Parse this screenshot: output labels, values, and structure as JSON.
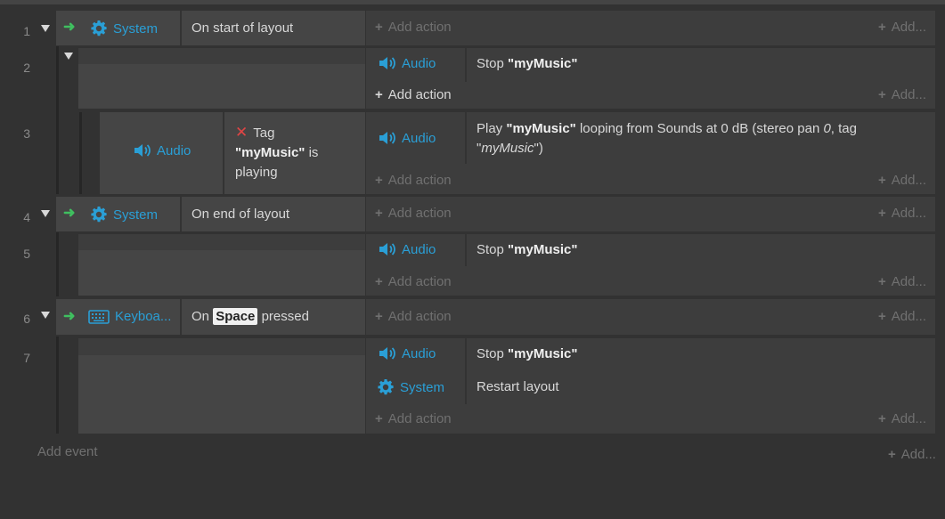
{
  "rows": [
    {
      "num": "1"
    },
    {
      "num": "2"
    },
    {
      "num": "3"
    },
    {
      "num": "4"
    },
    {
      "num": "5"
    },
    {
      "num": "6"
    },
    {
      "num": "7"
    }
  ],
  "objects": {
    "system": "System",
    "audio": "Audio",
    "keyboard": "Keyboa..."
  },
  "events": {
    "e1": {
      "condition": "On start of layout"
    },
    "e2": {
      "action": {
        "verb": "Stop",
        "name": "\"myMusic\""
      }
    },
    "e3": {
      "condition": {
        "word": "Tag",
        "name": "\"myMusic\"",
        "rest": " is playing"
      },
      "action": {
        "verb": "Play ",
        "name": "\"myMusic\"",
        "mid": " looping from Sounds at 0 dB (stereo pan ",
        "pan": "0",
        "mid2": ", tag \"",
        "tag": "myMusic",
        "end": "\")"
      }
    },
    "e4": {
      "condition": "On end of layout"
    },
    "e5": {
      "action": {
        "verb": "Stop",
        "name": "\"myMusic\""
      }
    },
    "e6": {
      "condition": {
        "pre": "On",
        "key": "Space",
        "post": "pressed"
      }
    },
    "e7": {
      "action1": {
        "verb": "Stop",
        "name": "\"myMusic\""
      },
      "action2": "Restart layout"
    }
  },
  "labels": {
    "add_action": "Add action",
    "add_short": "Add...",
    "add_event": "Add event"
  },
  "icons": {
    "enter": "arrow-right-icon",
    "system": "gear-icon",
    "audio": "speaker-icon",
    "keyboard": "keyboard-icon",
    "invert": "close-icon",
    "collapse": "triangle-down-icon"
  },
  "colors": {
    "background": "#323232",
    "object_name": "#2a9fd6",
    "trigger_arrow": "#3fbf5f",
    "invert_x": "#e04545"
  }
}
